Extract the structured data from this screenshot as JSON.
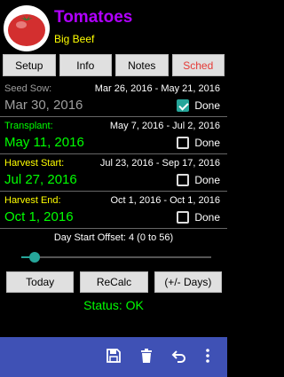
{
  "header": {
    "title": "Tomatoes",
    "subtitle": "Big Beef"
  },
  "tabs": [
    {
      "label": "Setup",
      "active": false
    },
    {
      "label": "Info",
      "active": false
    },
    {
      "label": "Notes",
      "active": false
    },
    {
      "label": "Sched",
      "active": true
    }
  ],
  "schedule": [
    {
      "label": "Seed Sow:",
      "range": "Mar 26, 2016 - May 21, 2016",
      "date": "Mar 30, 2016",
      "done_label": "Done",
      "done": true,
      "label_color": "#9e9e9e",
      "date_color": "#9e9e9e"
    },
    {
      "label": "Transplant:",
      "range": "May 7, 2016 - Jul 2, 2016",
      "date": "May 11, 2016",
      "done_label": "Done",
      "done": false,
      "label_color": "#00ff00",
      "date_color": "#00ff00"
    },
    {
      "label": "Harvest Start:",
      "range": "Jul 23, 2016 - Sep 17, 2016",
      "date": "Jul 27, 2016",
      "done_label": "Done",
      "done": false,
      "label_color": "#ffff00",
      "date_color": "#00ff00"
    },
    {
      "label": "Harvest End:",
      "range": "Oct 1, 2016 - Oct 1, 2016",
      "date": "Oct 1, 2016",
      "done_label": "Done",
      "done": false,
      "label_color": "#ffff00",
      "date_color": "#00ff00"
    }
  ],
  "offset": {
    "text": "Day Start Offset: 4 (0 to 56)",
    "value": 4,
    "min": 0,
    "max": 56
  },
  "actions": {
    "today": "Today",
    "recalc": "ReCalc",
    "plusminus": "(+/- Days)"
  },
  "status": "Status: OK",
  "colors": {
    "accent": "#26a69a",
    "bottombar": "#3f51b5",
    "title": "#b000ff",
    "subtitle": "#ffff00"
  },
  "icons": [
    "save-icon",
    "delete-icon",
    "undo-icon",
    "overflow-menu-icon"
  ]
}
